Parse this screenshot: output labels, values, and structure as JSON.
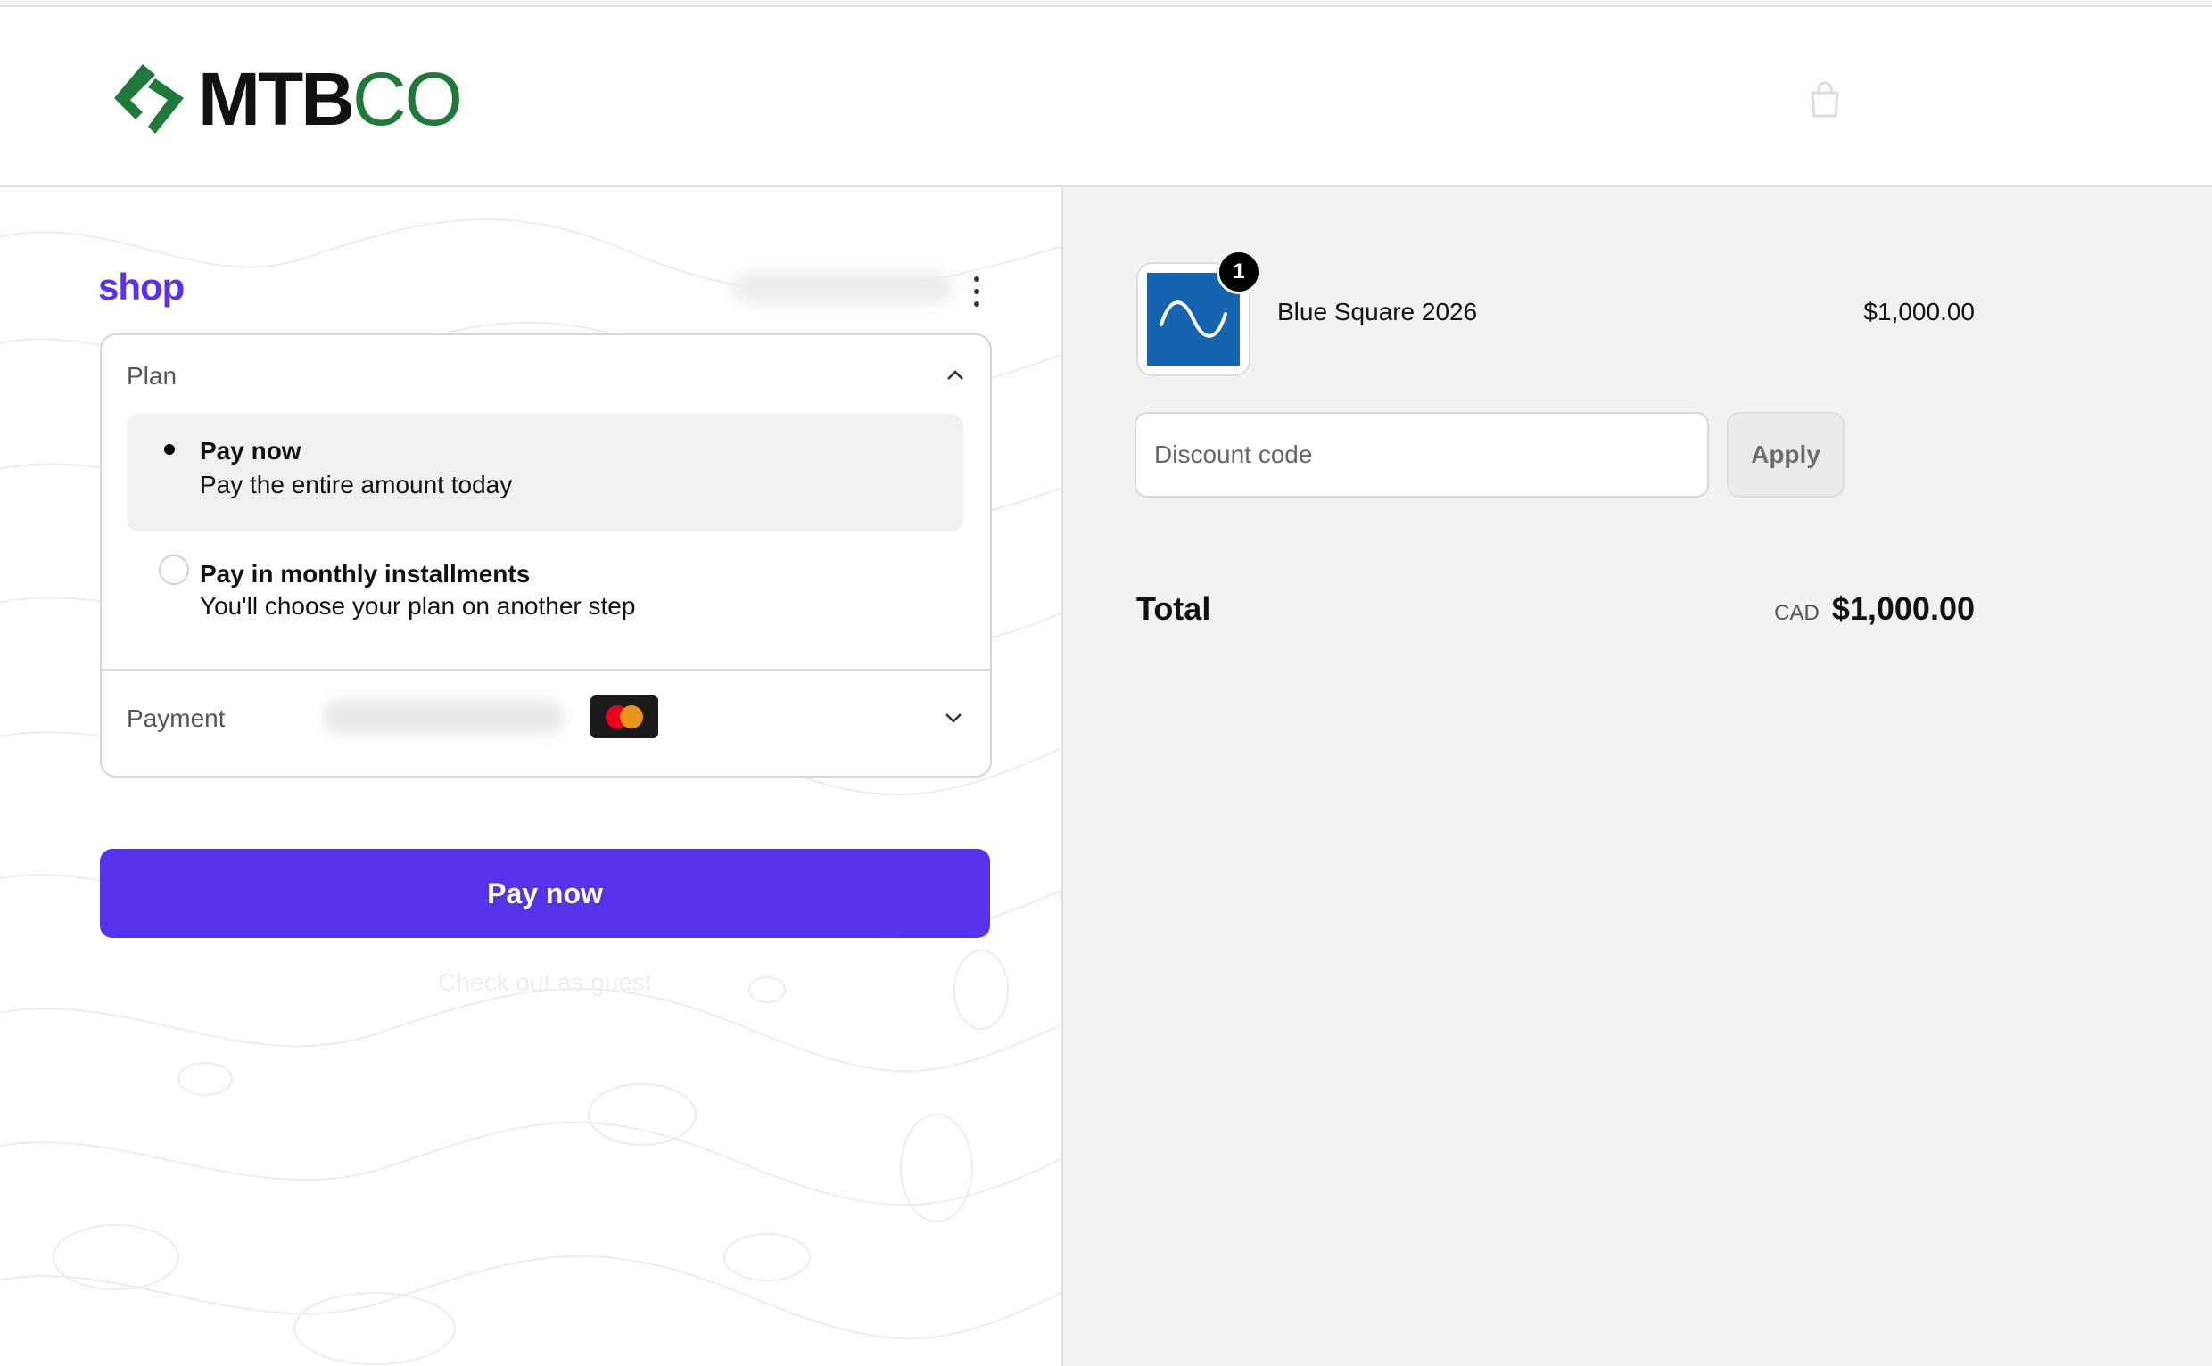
{
  "header": {
    "logo_text_a": "MTB",
    "logo_text_b": "CO",
    "brand_color": "#1f7a3a"
  },
  "checkout": {
    "shop_brand": "shop",
    "plan": {
      "label": "Plan",
      "options": [
        {
          "title": "Pay now",
          "subtitle": "Pay the entire amount today",
          "selected": true
        },
        {
          "title": "Pay in monthly installments",
          "subtitle": "You'll choose your plan on another step",
          "selected": false
        }
      ]
    },
    "payment": {
      "label": "Payment",
      "card_brand": "mastercard-icon"
    },
    "pay_button": "Pay now",
    "guest_link": "Check out as guest",
    "accent_color": "#5433eb"
  },
  "summary": {
    "product": {
      "name": "Blue Square 2026",
      "price": "$1,000.00",
      "quantity": "1"
    },
    "discount": {
      "placeholder": "Discount code",
      "apply_label": "Apply"
    },
    "total": {
      "label": "Total",
      "currency": "CAD",
      "value": "$1,000.00"
    }
  }
}
